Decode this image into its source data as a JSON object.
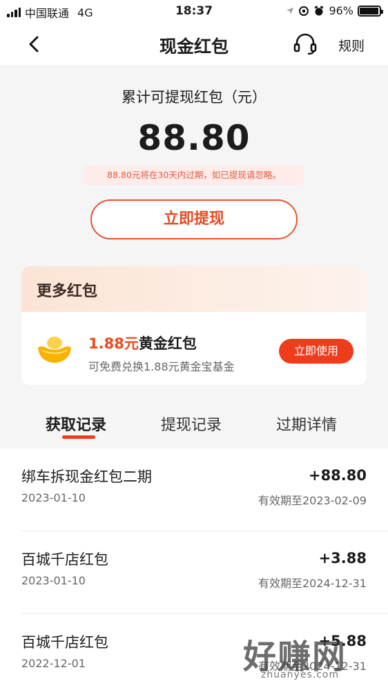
{
  "status_bar": {
    "carrier": "中国联通",
    "network": "4G",
    "time": "18:37",
    "battery": "96%",
    "battery_level": 0.96
  },
  "header": {
    "title": "现金红包",
    "rules_label": "规则",
    "icons": {
      "back": "chevron-left-icon",
      "service": "headset-icon"
    }
  },
  "summary": {
    "label": "累计可提现红包（元）",
    "amount": "88.80",
    "expire_note": "88.80元将在30天内过期，如已提现请忽略。",
    "withdraw_label": "立即提现"
  },
  "more_card": {
    "title": "更多红包",
    "item": {
      "amount": "1.88元",
      "name": "黄金红包",
      "subtitle": "可免费兑换1.88元黄金宝基金",
      "button": "立即使用",
      "icon": "gold-ingot-icon"
    }
  },
  "tabs": [
    {
      "label": "获取记录",
      "active": true
    },
    {
      "label": "提现记录",
      "active": false
    },
    {
      "label": "过期详情",
      "active": false
    }
  ],
  "records": [
    {
      "name": "绑车拆现金红包二期",
      "date": "2023-01-10",
      "amount": "+88.80",
      "valid": "有效期至2023-02-09"
    },
    {
      "name": "百城千店红包",
      "date": "2023-01-10",
      "amount": "+3.88",
      "valid": "有效期至2024-12-31"
    },
    {
      "name": "百城千店红包",
      "date": "2022-12-01",
      "amount": "+5.88",
      "valid": "有效期至2024-12-31"
    }
  ],
  "watermark": {
    "text": "好赚网",
    "url": "zhuanyes.com"
  },
  "colors": {
    "accent": "#ee3d1c",
    "note_bg": "#fdecea",
    "card_head": "#fbe4d6"
  }
}
